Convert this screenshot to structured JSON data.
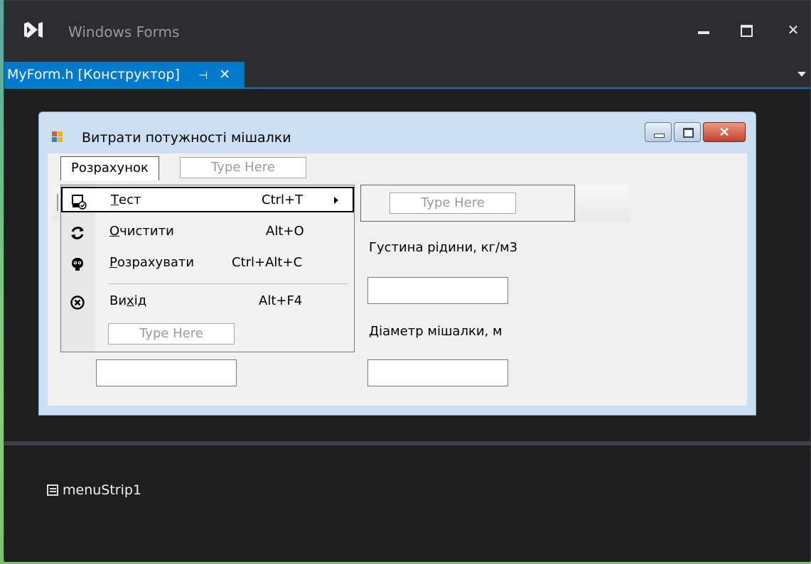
{
  "ide": {
    "title": "Windows Forms",
    "tab": {
      "label": "MyForm.h [Конструктор]",
      "pin": "⊣",
      "close": "✕"
    },
    "window_buttons": {
      "close": "✕"
    },
    "tray": {
      "component": "menuStrip1"
    },
    "colors": {
      "accent": "#007acc",
      "background": "#1e1e1e",
      "chrome": "#2d2d30"
    }
  },
  "form": {
    "title": "Витрати потужності мішалки",
    "close_glyph": "✕",
    "menu": {
      "top_item": "Розрахунок",
      "type_here": "Type Here",
      "items": [
        {
          "label": "Тест",
          "mnemonic": "Т",
          "rest": "ест",
          "shortcut": "Ctrl+T",
          "icon": "computer-check-icon",
          "has_submenu": true
        },
        {
          "label": "Очистити",
          "mnemonic": "О",
          "rest": "чистити",
          "shortcut": "Alt+O",
          "icon": "refresh-icon"
        },
        {
          "label": "Розрахувати",
          "mnemonic": "Р",
          "rest": "озрахувати",
          "shortcut": "Ctrl+Alt+C",
          "icon": "calculator-mascot-icon"
        },
        {
          "label": "Вихід",
          "pre": "Ви",
          "mnemonic": "х",
          "post": "ід",
          "shortcut": "Alt+F4",
          "icon": "exit-circle-x-icon"
        }
      ]
    },
    "labels": {
      "density": "Густина рідини, кг/м3",
      "diameter": "Діаметр мішалки, м"
    }
  }
}
